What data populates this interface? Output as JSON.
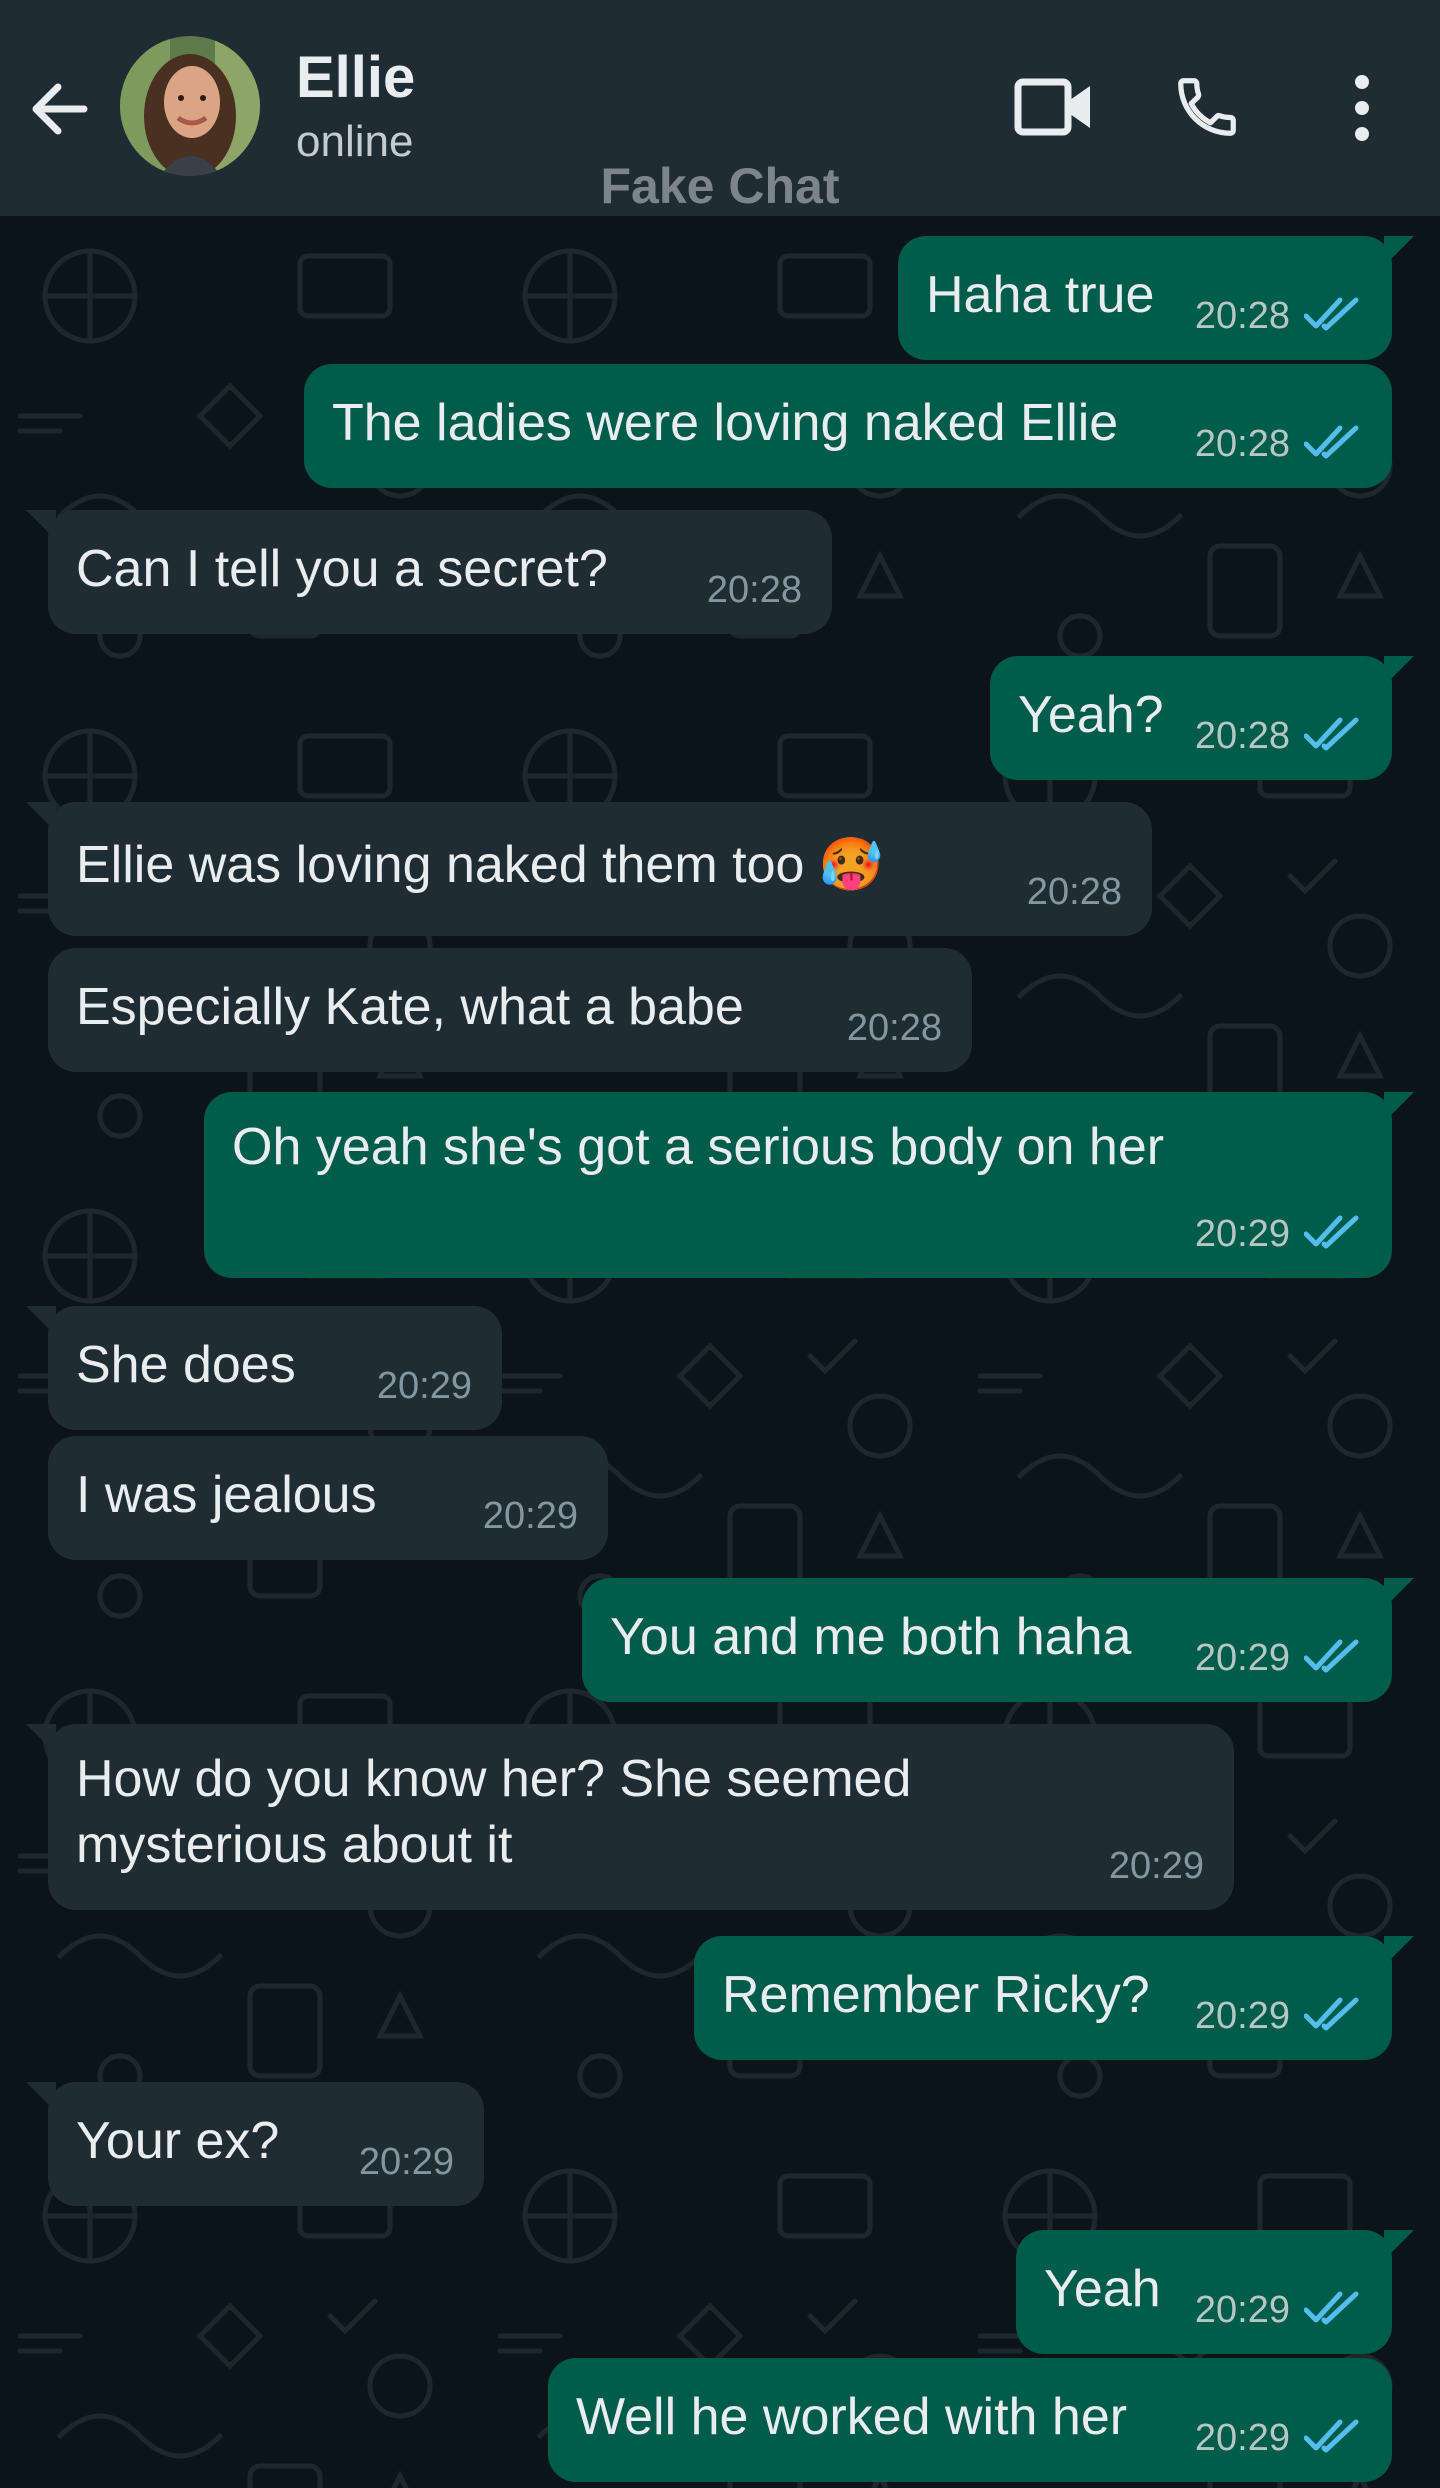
{
  "header": {
    "contact_name": "Ellie",
    "contact_status": "online",
    "watermark": "Fake Chat"
  },
  "colors": {
    "header_bg": "#1f2c34",
    "chat_bg": "#0b141a",
    "outgoing_bubble": "#005c4b",
    "incoming_bubble": "#202c33",
    "read_ticks": "#53bdeb"
  },
  "icons": {
    "back": "arrow-left-icon",
    "video": "video-call-icon",
    "call": "phone-icon",
    "menu": "more-vertical-icon"
  },
  "messages": [
    {
      "dir": "out",
      "text": "Haha true",
      "time": "20:28",
      "read": true
    },
    {
      "dir": "out",
      "text": "The ladies were loving naked Ellie",
      "time": "20:28",
      "read": true
    },
    {
      "dir": "in",
      "text": "Can I tell you a secret?",
      "time": "20:28"
    },
    {
      "dir": "out",
      "text": "Yeah?",
      "time": "20:28",
      "read": true
    },
    {
      "dir": "in",
      "text": "Ellie was loving naked them too 🥵",
      "time": "20:28"
    },
    {
      "dir": "in",
      "text": "Especially Kate, what a babe",
      "time": "20:28"
    },
    {
      "dir": "out",
      "text": "Oh yeah she's got a serious body on her",
      "time": "20:29",
      "read": true
    },
    {
      "dir": "in",
      "text": "She does",
      "time": "20:29"
    },
    {
      "dir": "in",
      "text": "I was jealous",
      "time": "20:29"
    },
    {
      "dir": "out",
      "text": "You and me both haha",
      "time": "20:29",
      "read": true
    },
    {
      "dir": "in",
      "text": "How do you know her? She seemed",
      "text2": "mysterious about it",
      "time": "20:29"
    },
    {
      "dir": "out",
      "text": "Remember Ricky?",
      "time": "20:29",
      "read": true
    },
    {
      "dir": "in",
      "text": "Your ex?",
      "time": "20:29"
    },
    {
      "dir": "out",
      "text": "Yeah",
      "time": "20:29",
      "read": true
    },
    {
      "dir": "out",
      "text": "Well he worked with her",
      "time": "20:29",
      "read": true
    }
  ]
}
